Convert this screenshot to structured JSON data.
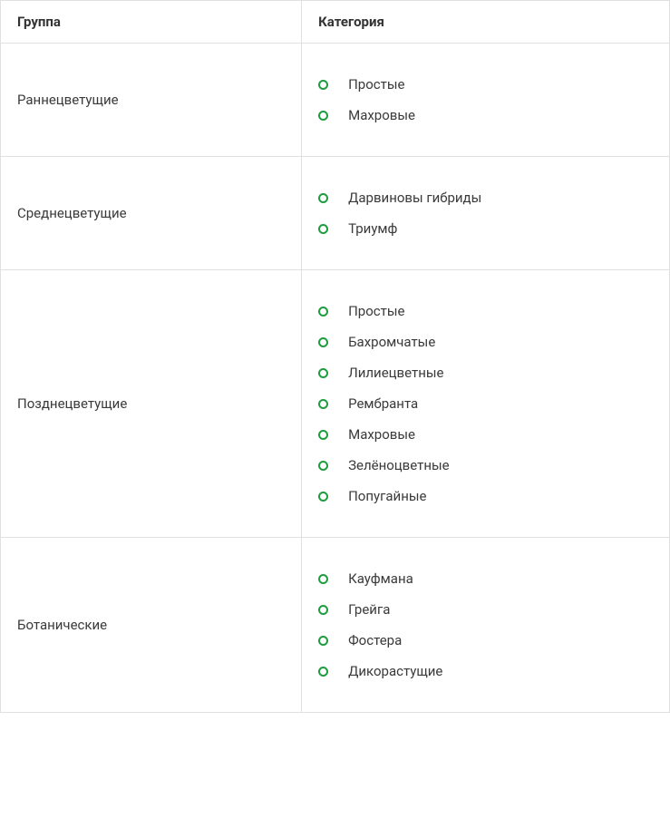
{
  "headers": {
    "group": "Группа",
    "category": "Категория"
  },
  "rows": [
    {
      "group": "Раннецветущие",
      "categories": [
        "Простые",
        "Махровые"
      ]
    },
    {
      "group": "Среднецветущие",
      "categories": [
        "Дарвиновы гибриды",
        "Триумф"
      ]
    },
    {
      "group": "Позднецветущие",
      "categories": [
        "Простые",
        "Бахромчатые",
        "Лилиецветные",
        "Рембранта",
        "Махровые",
        "Зелёноцветные",
        "Попугайные"
      ]
    },
    {
      "group": "Ботанические",
      "categories": [
        "Кауфмана",
        "Грейга",
        "Фостера",
        "Дикорастущие"
      ]
    }
  ]
}
